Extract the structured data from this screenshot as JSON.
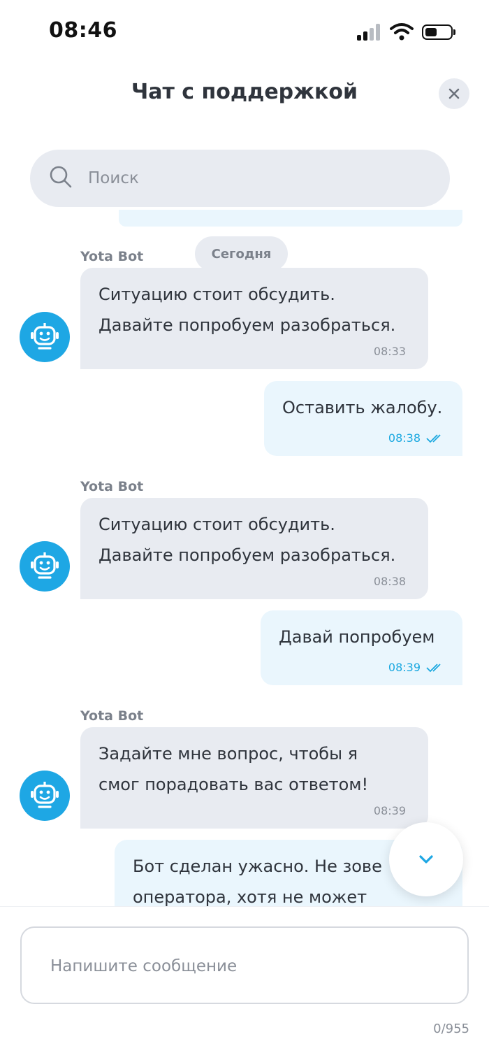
{
  "status_bar": {
    "time": "08:46"
  },
  "header": {
    "title": "Чат с поддержкой"
  },
  "search": {
    "placeholder": "Поиск"
  },
  "chat": {
    "date_separator": "Сегодня",
    "messages": [
      {
        "from": "bot",
        "sender": "Yota Bot",
        "text": "Ситуацию стоит обсудить.\nДавайте попробуем разобраться.",
        "time": "08:33"
      },
      {
        "from": "user",
        "text": "Оставить жалобу.",
        "time": "08:38",
        "status": "read"
      },
      {
        "from": "bot",
        "sender": "Yota Bot",
        "text": "Ситуацию стоит обсудить.\nДавайте попробуем разобраться.",
        "time": "08:38"
      },
      {
        "from": "user",
        "text": "Давай попробуем",
        "time": "08:39",
        "status": "read"
      },
      {
        "from": "bot",
        "sender": "Yota Bot",
        "text": "Задайте мне вопрос, чтобы я\nсмог порадовать вас ответом!",
        "time": "08:39"
      },
      {
        "from": "user",
        "text": "Бот сделан ужасно. Не зове\nоператора, хотя не может"
      }
    ]
  },
  "composer": {
    "placeholder": "Напишите сообщение",
    "counter": "0/955"
  },
  "colors": {
    "accent": "#1ea7e4",
    "bot_bubble": "#e8ebf1",
    "user_bubble": "#eaf6fd"
  },
  "icons": [
    "signal-icon",
    "wifi-icon",
    "battery-icon",
    "close-icon",
    "search-icon",
    "robot-icon",
    "double-check-icon",
    "chevron-down-icon"
  ]
}
